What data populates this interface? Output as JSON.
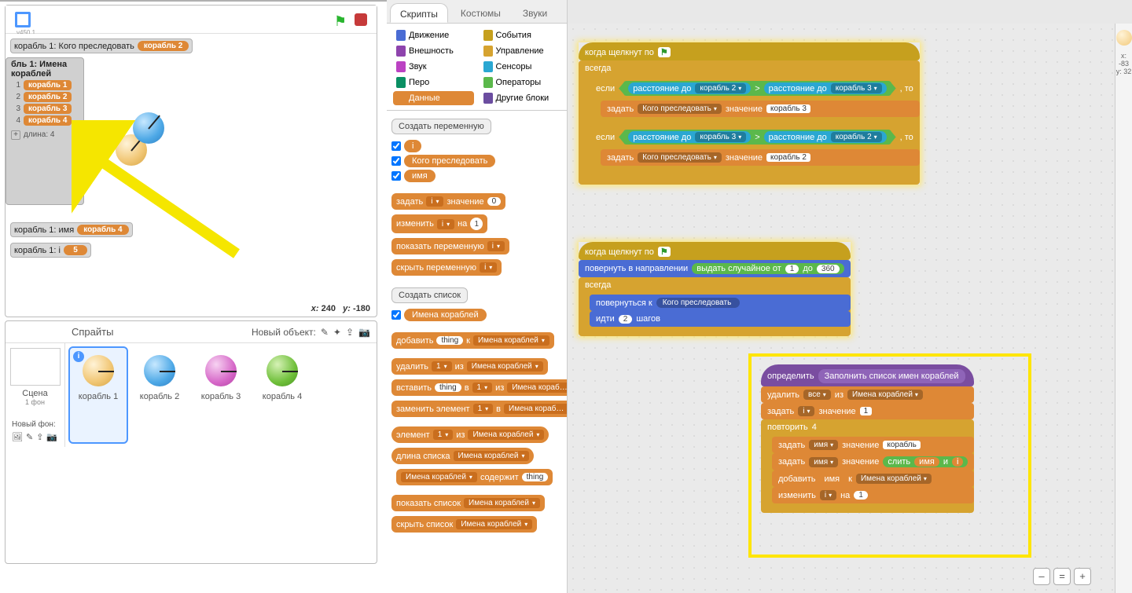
{
  "version": "v450.1",
  "stage": {
    "coords_x_label": "x:",
    "coords_x": "240",
    "coords_y_label": "y:",
    "coords_y": "-180"
  },
  "monitors": {
    "chase": {
      "label": "корабль 1: Кого преследовать",
      "value": "корабль 2"
    },
    "name": {
      "label": "корабль 1: имя",
      "value": "корабль 4"
    },
    "i": {
      "label": "корабль 1: i",
      "value": "5"
    }
  },
  "list": {
    "title": "бль 1: Имена кораблей",
    "rows": [
      "корабль 1",
      "корабль 2",
      "корабль 3",
      "корабль 4"
    ],
    "length_label": "длина: 4"
  },
  "sprite_panel": {
    "title": "Спрайты",
    "new_label": "Новый объект:",
    "stage_label": "Сцена",
    "stage_sub": "1 фон",
    "new_bg": "Новый фон:",
    "sprites": [
      "корабль 1",
      "корабль 2",
      "корабль 3",
      "корабль 4"
    ]
  },
  "tabs": [
    "Скрипты",
    "Костюмы",
    "Звуки"
  ],
  "categories": {
    "left": [
      "Движение",
      "Внешность",
      "Звук",
      "Перо",
      "Данные"
    ],
    "right": [
      "События",
      "Управление",
      "Сенсоры",
      "Операторы",
      "Другие блоки"
    ],
    "colors_left": [
      "#4a6cd4",
      "#8e44ad",
      "#bb42c3",
      "#0a8f63",
      "#de8836"
    ],
    "colors_right": [
      "#c6a01e",
      "#d6a330",
      "#2aa7d2",
      "#5bb84b",
      "#6b4da0"
    ]
  },
  "palette": {
    "make_var": "Создать переменную",
    "vars": [
      "i",
      "Кого преследовать",
      "имя"
    ],
    "blk_set": "задать",
    "blk_set_val": "значение",
    "zero": "0",
    "blk_change": "изменить",
    "blk_change_by": "на",
    "one": "1",
    "blk_show_var": "показать переменную",
    "blk_hide_var": "скрыть переменную",
    "make_list": "Создать список",
    "list_name": "Имена кораблей",
    "blk_add": "добавить",
    "thing": "thing",
    "to": "к",
    "blk_delete": "удалить",
    "one_dd": "1",
    "from": "из",
    "blk_insert": "вставить",
    "at": "в",
    "blk_replace": "заменить элемент",
    "blk_item": "элемент",
    "blk_len": "длина списка",
    "blk_contains": "содержит",
    "blk_show_list": "показать список",
    "blk_hide_list": "скрыть список"
  },
  "scripts": {
    "hdr_flag": "когда щелкнут по",
    "forever": "всегда",
    "if": "если",
    "then": ", то",
    "distance_to": "расстояние до",
    "ship2": "корабль 2",
    "ship3": "корабль 3",
    "set": "задать",
    "chase_var": "Кого преследовать",
    "val": "значение",
    "point_dir": "повернуть в направлении",
    "random": "выдать случайное от",
    "to": "до",
    "r1": "1",
    "r360": "360",
    "point_towards": "повернуться к",
    "move": "идти",
    "steps": "шагов",
    "two": "2",
    "define": "определить",
    "def_name": "Заполнить список имен кораблей",
    "delete": "удалить",
    "all": "все",
    "from": "из",
    "listn": "Имена кораблей",
    "set_i": "i",
    "set_val1": "1",
    "repeat": "повторить",
    "four": "4",
    "name_var": "имя",
    "korabl": "корабль",
    "join": "слить",
    "and": "и",
    "add": "добавить",
    "to2": "к",
    "change": "изменить",
    "by": "на"
  },
  "info": {
    "x_label": "x:",
    "x": "-83",
    "y_label": "y:",
    "y": "32"
  }
}
